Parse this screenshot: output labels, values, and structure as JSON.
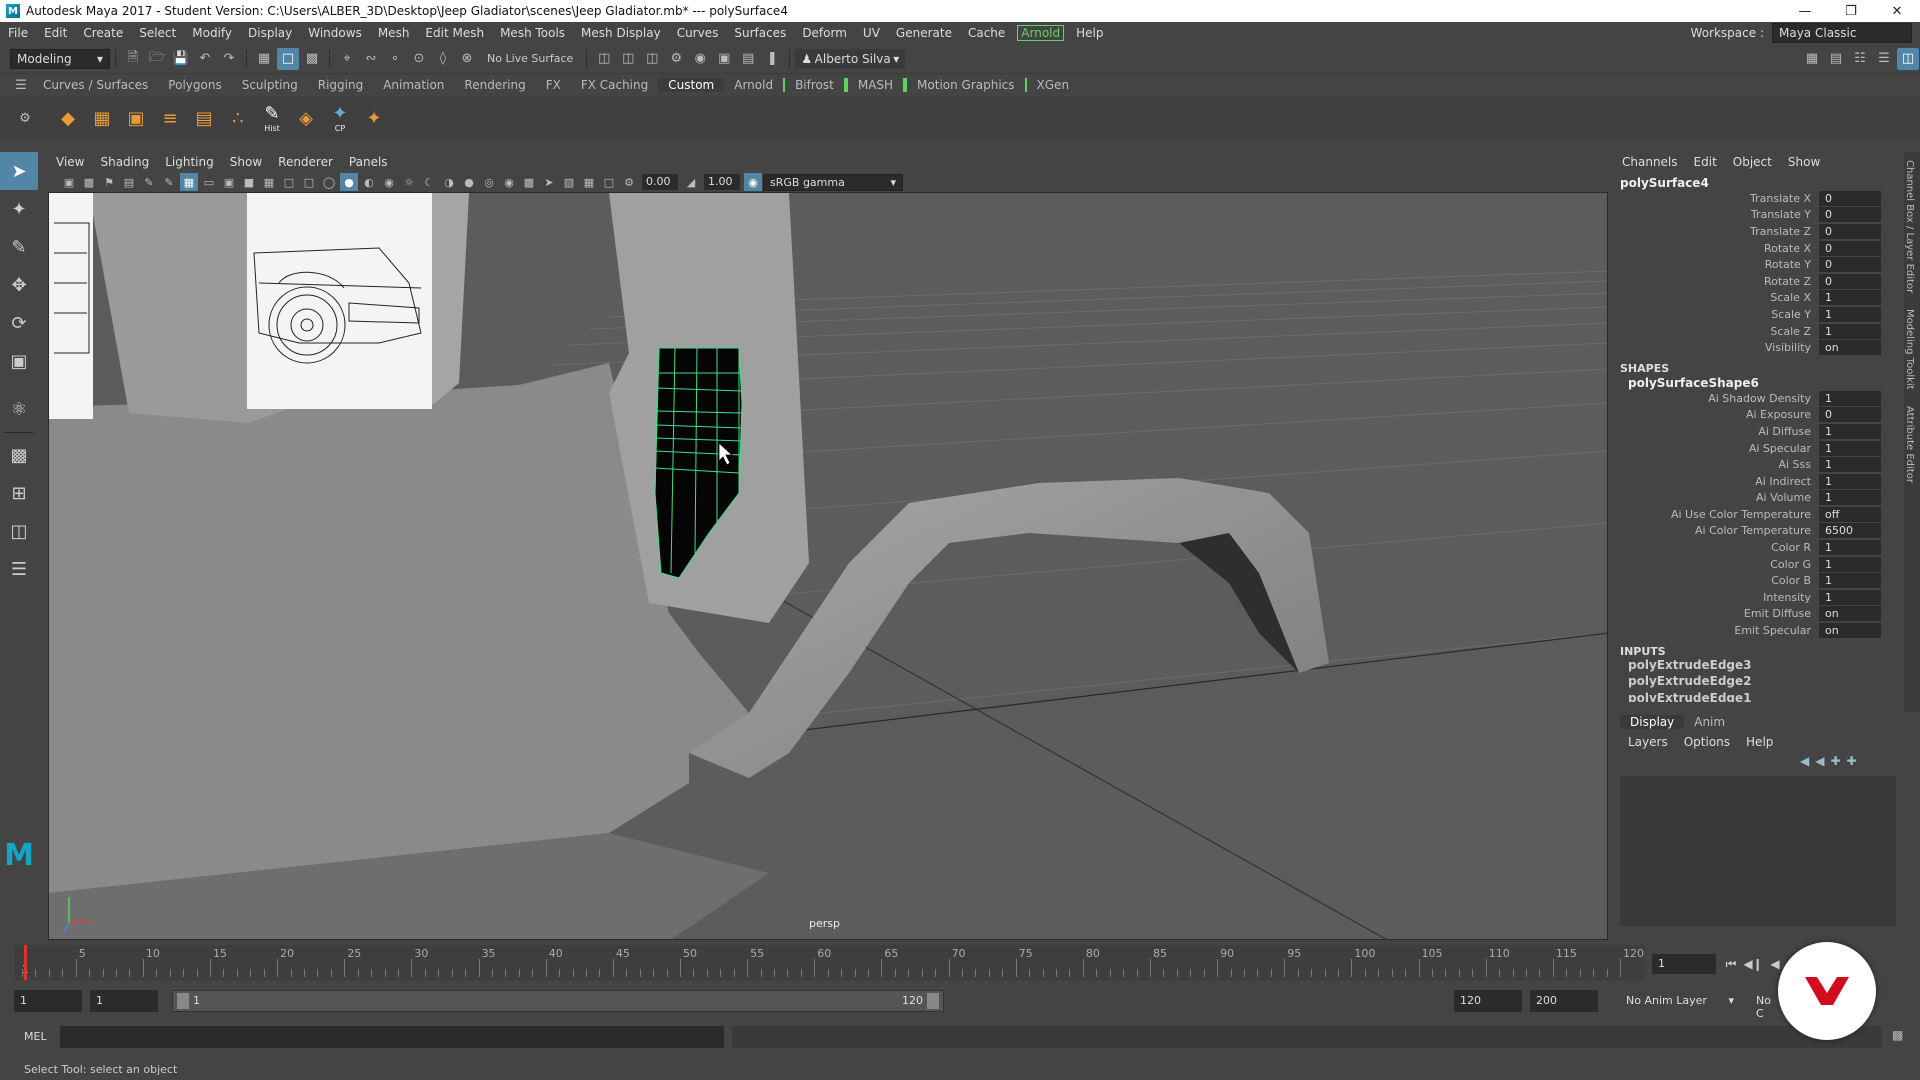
{
  "window": {
    "title": "Autodesk Maya 2017 - Student Version: C:\\Users\\ALBER_3D\\Desktop\\Jeep Gladiator\\scenes\\Jeep Gladiator.mb*   ---   polySurface4",
    "logo_letter": "M"
  },
  "menubar": {
    "items": [
      "File",
      "Edit",
      "Create",
      "Select",
      "Modify",
      "Display",
      "Windows",
      "Mesh",
      "Edit Mesh",
      "Mesh Tools",
      "Mesh Display",
      "Curves",
      "Surfaces",
      "Deform",
      "UV",
      "Generate",
      "Cache",
      "Arnold",
      "Help"
    ],
    "workspace_label": "Workspace :",
    "workspace_value": "Maya Classic"
  },
  "statusline": {
    "mode": "Modeling",
    "live_surface": "No Live Surface",
    "user": "Alberto Silva"
  },
  "shelf": {
    "tabs": [
      "Curves / Surfaces",
      "Polygons",
      "Sculpting",
      "Rigging",
      "Animation",
      "Rendering",
      "FX",
      "FX Caching",
      "Custom",
      "Arnold",
      "Bifrost",
      "MASH",
      "Motion Graphics",
      "XGen"
    ],
    "active_tab": "Custom",
    "icons": [
      "◆",
      "▦",
      "▣",
      "≡",
      "▤",
      "∴",
      "Hist",
      "◈",
      "CP",
      "✦"
    ],
    "hist_label": "Hist",
    "cp_label": "CP"
  },
  "viewport": {
    "menu": [
      "View",
      "Shading",
      "Lighting",
      "Show",
      "Renderer",
      "Panels"
    ],
    "exposure": "0.00",
    "gamma": "1.00",
    "color_space": "sRGB gamma",
    "camera_label": "persp"
  },
  "channelbox": {
    "menu": [
      "Channels",
      "Edit",
      "Object",
      "Show"
    ],
    "object": "polySurface4",
    "transform": [
      {
        "label": "Translate X",
        "value": "0"
      },
      {
        "label": "Translate Y",
        "value": "0"
      },
      {
        "label": "Translate Z",
        "value": "0"
      },
      {
        "label": "Rotate X",
        "value": "0"
      },
      {
        "label": "Rotate Y",
        "value": "0"
      },
      {
        "label": "Rotate Z",
        "value": "0"
      },
      {
        "label": "Scale X",
        "value": "1"
      },
      {
        "label": "Scale Y",
        "value": "1"
      },
      {
        "label": "Scale Z",
        "value": "1"
      },
      {
        "label": "Visibility",
        "value": "on"
      }
    ],
    "shapes_header": "SHAPES",
    "shape_name": "polySurfaceShape6",
    "shape_attrs": [
      {
        "label": "Ai Shadow Density",
        "value": "1"
      },
      {
        "label": "Ai Exposure",
        "value": "0"
      },
      {
        "label": "Ai Diffuse",
        "value": "1"
      },
      {
        "label": "Ai Specular",
        "value": "1"
      },
      {
        "label": "Ai Sss",
        "value": "1"
      },
      {
        "label": "Ai Indirect",
        "value": "1"
      },
      {
        "label": "Ai Volume",
        "value": "1"
      },
      {
        "label": "Ai Use Color Temperature",
        "value": "off"
      },
      {
        "label": "Ai Color Temperature",
        "value": "6500"
      },
      {
        "label": "Color R",
        "value": "1"
      },
      {
        "label": "Color G",
        "value": "1"
      },
      {
        "label": "Color B",
        "value": "1"
      },
      {
        "label": "Intensity",
        "value": "1"
      },
      {
        "label": "Emit Diffuse",
        "value": "on"
      },
      {
        "label": "Emit Specular",
        "value": "on"
      }
    ],
    "inputs_header": "INPUTS",
    "inputs": [
      "polyExtrudeEdge3",
      "polyExtrudeEdge2",
      "polyExtrudeEdge1"
    ]
  },
  "side_tabs": [
    "Channel Box / Layer Editor",
    "Modeling Toolkit",
    "Attribute Editor"
  ],
  "layer_editor": {
    "tabs": [
      "Display",
      "Anim"
    ],
    "menu": [
      "Layers",
      "Options",
      "Help"
    ]
  },
  "timeline": {
    "ticks": [
      5,
      10,
      15,
      20,
      25,
      30,
      35,
      40,
      45,
      50,
      55,
      60,
      65,
      70,
      75,
      80,
      85,
      90,
      95,
      100,
      105,
      110,
      115,
      120
    ],
    "start_marker": "1",
    "current_frame": "1"
  },
  "range": {
    "start": "1",
    "playback_start": "1",
    "slider_start": "1",
    "slider_end": "120",
    "playback_end": "120",
    "end": "200",
    "anim_layer": "No Anim Layer",
    "char_set": "No C"
  },
  "cmdline": {
    "label": "MEL"
  },
  "help_line": "Select Tool: select an object",
  "colors": {
    "accent": "#5285a6",
    "wire": "#3de08a",
    "arnold_green": "#5fd35f",
    "badge_red": "#d10c1d"
  }
}
